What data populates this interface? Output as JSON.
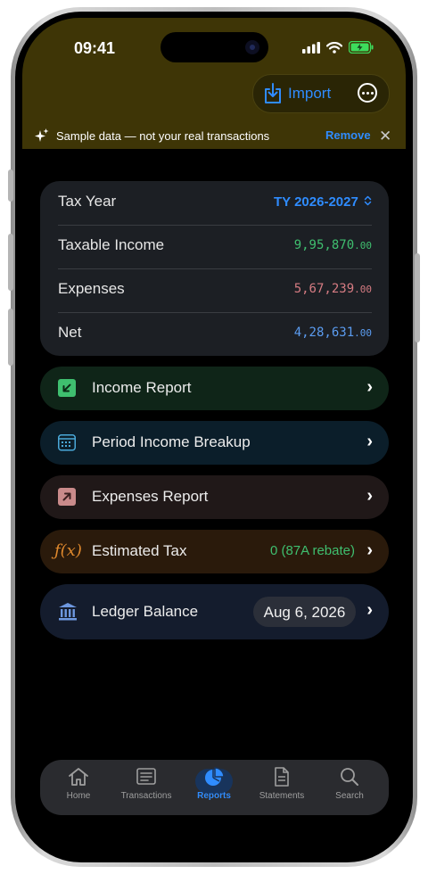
{
  "status_bar": {
    "time": "09:41"
  },
  "header": {
    "import_label": "Import",
    "more_icon": "ellipsis-circle-icon"
  },
  "banner": {
    "text": "Sample data — not your real transactions",
    "remove_label": "Remove"
  },
  "summary": {
    "tax_year_label": "Tax Year",
    "tax_year_value": "TY 2026-2027",
    "rows": [
      {
        "label": "Taxable Income",
        "value": "9,95,870",
        "decimals": ".00",
        "color": "#3fbf6f"
      },
      {
        "label": "Expenses",
        "value": "5,67,239",
        "decimals": ".00",
        "color": "#d57b82"
      },
      {
        "label": "Net",
        "value": "4,28,631",
        "decimals": ".00",
        "color": "#5b9cf0"
      }
    ]
  },
  "reports": {
    "income_report": "Income Report",
    "period_income_breakup": "Period Income Breakup",
    "expenses_report": "Expenses Report",
    "estimated_tax": "Estimated Tax",
    "estimated_tax_value": "0 (87A rebate)",
    "ledger_balance": "Ledger Balance",
    "ledger_date": "Aug 6, 2026"
  },
  "tabs": [
    {
      "label": "Home",
      "icon": "house-icon"
    },
    {
      "label": "Transactions",
      "icon": "list-icon"
    },
    {
      "label": "Reports",
      "icon": "pie-chart-icon",
      "active": true
    },
    {
      "label": "Statements",
      "icon": "document-icon"
    },
    {
      "label": "Search",
      "icon": "magnifier-icon"
    }
  ],
  "colors": {
    "accent": "#2f8cff",
    "income": "#3fbf6f",
    "expense": "#d57b82",
    "net": "#5b9cf0",
    "tax": "#e0892d",
    "header_bg": "#3e3506"
  }
}
